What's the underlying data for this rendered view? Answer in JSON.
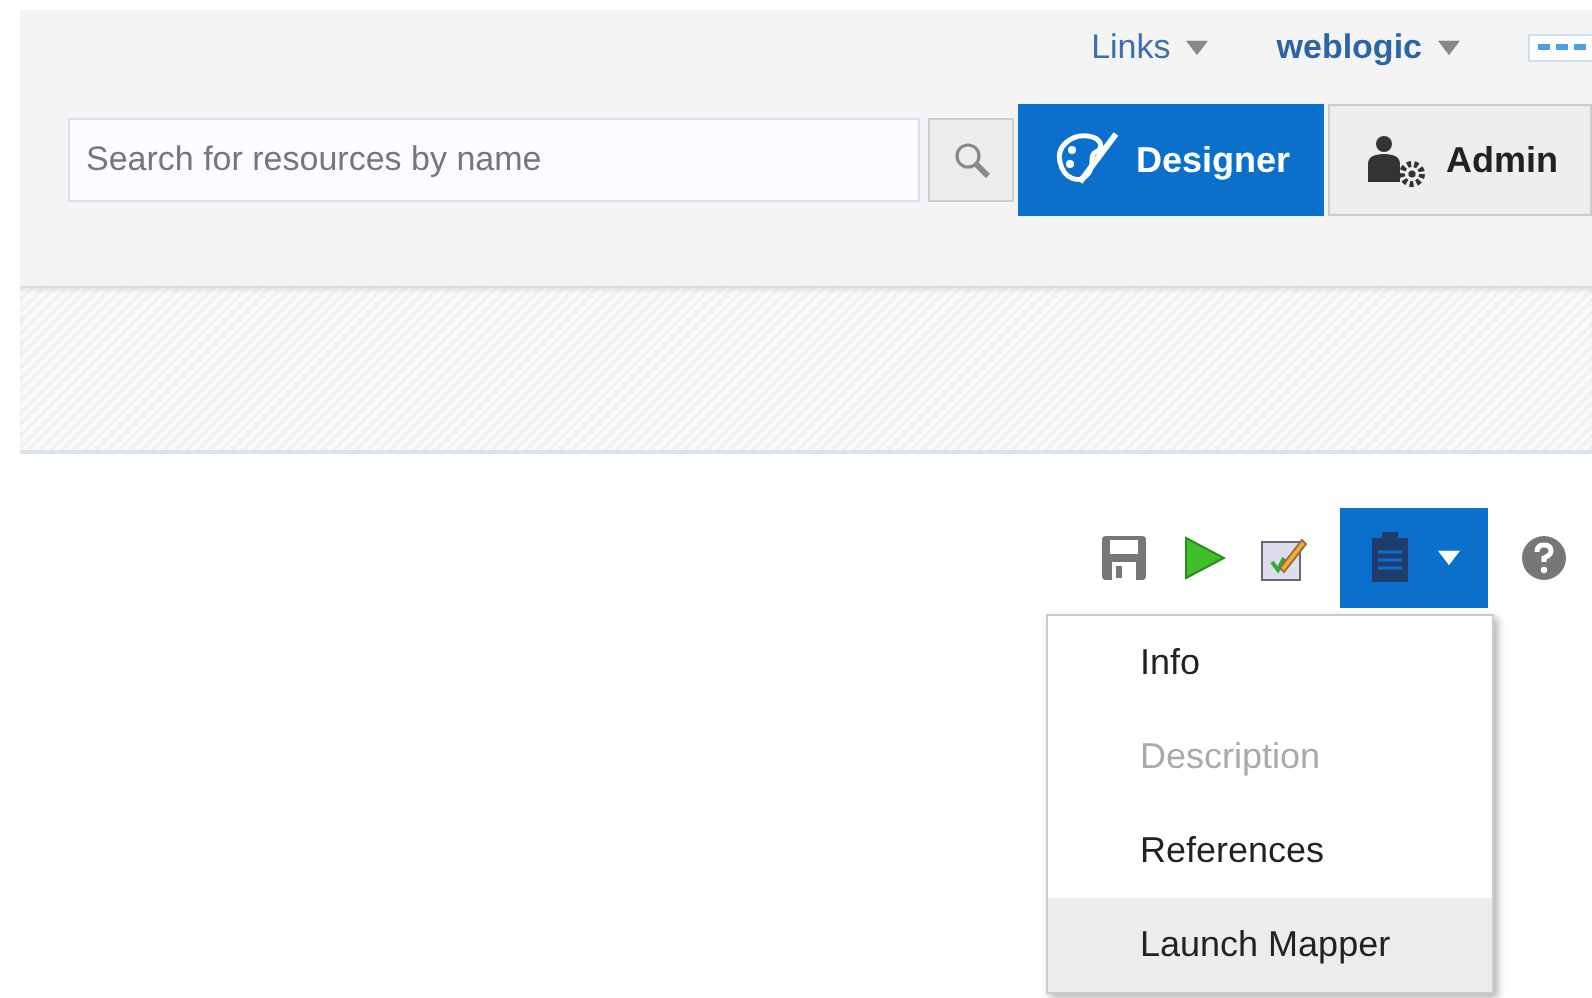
{
  "header": {
    "links": [
      {
        "label": "Links",
        "kind": "plain"
      },
      {
        "label": "weblogic",
        "kind": "bold"
      }
    ],
    "search": {
      "placeholder": "Search for resources by name"
    },
    "modes": [
      {
        "label": "Designer",
        "selected": true,
        "kind": "designer"
      },
      {
        "label": "Admin",
        "selected": false,
        "kind": "admin"
      }
    ]
  },
  "toolbar": {
    "tools": [
      {
        "kind": "save"
      },
      {
        "kind": "run"
      },
      {
        "kind": "edit"
      },
      {
        "kind": "clipboard",
        "expanded": true
      },
      {
        "kind": "help"
      }
    ]
  },
  "menu": {
    "items": [
      {
        "label": "Info",
        "disabled": false,
        "selected": false
      },
      {
        "label": "Description",
        "disabled": true,
        "selected": false
      },
      {
        "label": "References",
        "disabled": false,
        "selected": false
      },
      {
        "label": "Launch Mapper",
        "disabled": false,
        "selected": true
      }
    ]
  }
}
